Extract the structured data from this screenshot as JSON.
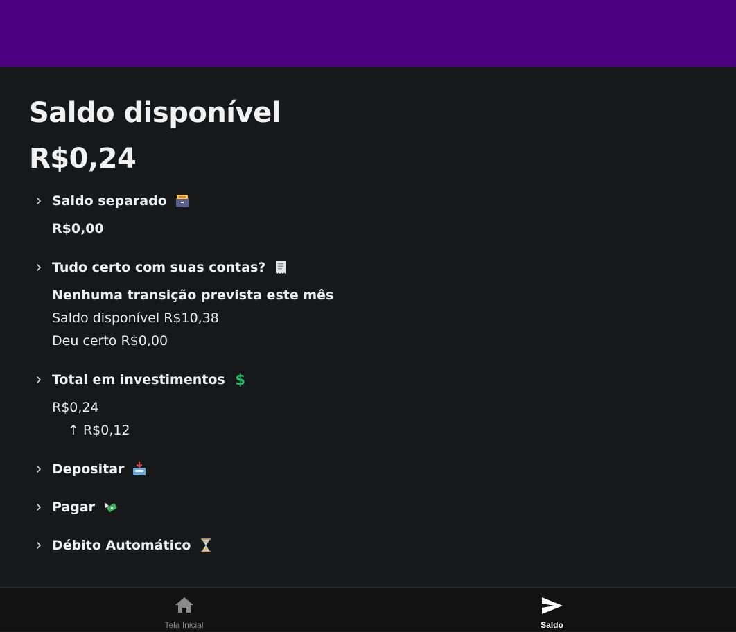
{
  "header": {
    "color": "#4b0082"
  },
  "page": {
    "title": "Saldo disponível",
    "balance": "R$0,24"
  },
  "sections": {
    "separado": {
      "title": "Saldo separado",
      "icon": "file-cabinet-icon",
      "value": "R$0,00"
    },
    "contas": {
      "title": "Tudo certo com suas contas?",
      "icon": "receipt-icon",
      "headline": "Nenhuma transição prevista este mês",
      "line1": "Saldo disponível R$10,38",
      "line2": "Deu certo R$0,00"
    },
    "investimentos": {
      "title": "Total em investimentos",
      "icon": "dollar-sign-icon",
      "value": "R$0,24",
      "change": "↑ R$0,12"
    },
    "depositar": {
      "title": "Depositar",
      "icon": "inbox-tray-icon"
    },
    "pagar": {
      "title": "Pagar",
      "icon": "money-with-wings-icon"
    },
    "debito": {
      "title": "Débito Automático",
      "icon": "hourglass-icon"
    }
  },
  "nav": {
    "home": {
      "label": "Tela Inicial",
      "icon": "home-icon",
      "active": false
    },
    "saldo": {
      "label": "Saldo",
      "icon": "send-icon",
      "active": true
    }
  }
}
